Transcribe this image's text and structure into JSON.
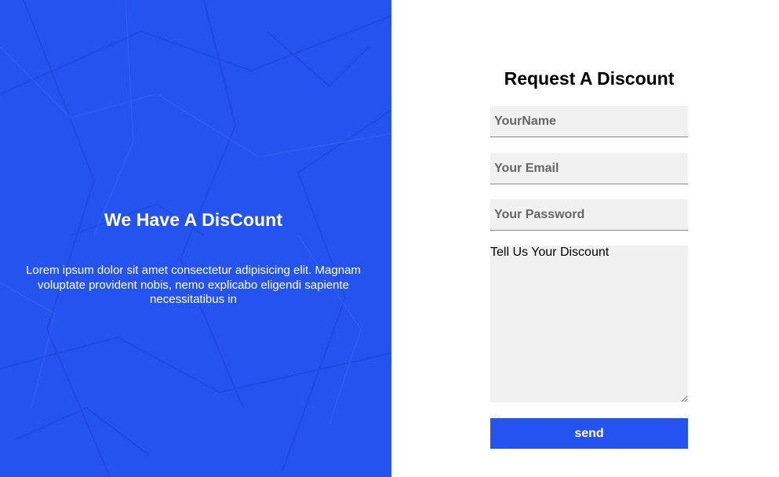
{
  "promo": {
    "title": "We Have A DisCount",
    "text": "Lorem ipsum dolor sit amet consectetur adipisicing elit. Magnam voluptate provident nobis, nemo explicabo eligendi sapiente necessitatibus in"
  },
  "form": {
    "title": "Request A Discount",
    "name_placeholder": "YourName",
    "email_placeholder": "Your Email",
    "password_placeholder": "Your Password",
    "message_placeholder": "Tell Us Your Discount",
    "send_label": "send"
  },
  "colors": {
    "accent": "#2553ef",
    "field_background": "#f1f1f1"
  }
}
